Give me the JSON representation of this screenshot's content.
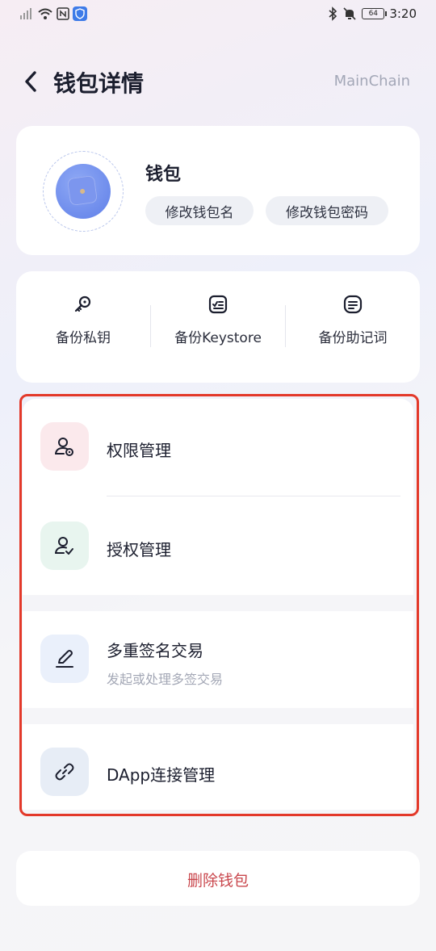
{
  "status_bar": {
    "time": "3:20",
    "battery": "64",
    "icons": [
      "signal-icon",
      "wifi-icon",
      "nfc-icon",
      "shield-app-icon",
      "bluetooth-icon",
      "mute-icon",
      "battery-icon"
    ]
  },
  "header": {
    "title": "钱包详情",
    "network": "MainChain"
  },
  "wallet": {
    "name": "钱包",
    "rename_label": "修改钱包名",
    "change_password_label": "修改钱包密码"
  },
  "backup": {
    "items": [
      {
        "label": "备份私钥",
        "icon": "key-icon"
      },
      {
        "label": "备份Keystore",
        "icon": "keystore-icon"
      },
      {
        "label": "备份助记词",
        "icon": "mnemonic-icon"
      }
    ]
  },
  "menu": {
    "items": [
      {
        "label": "权限管理",
        "icon": "user-settings-icon",
        "icon_bg": "#fbe9ec"
      },
      {
        "label": "授权管理",
        "icon": "user-check-icon",
        "icon_bg": "#e8f5ef"
      },
      {
        "label": "多重签名交易",
        "sub": "发起或处理多签交易",
        "icon": "pen-icon",
        "icon_bg": "#eaf0fb"
      },
      {
        "label": "DApp连接管理",
        "icon": "link-icon",
        "icon_bg": "#e7edf6"
      }
    ]
  },
  "delete": {
    "label": "删除钱包"
  },
  "colors": {
    "highlight_border": "#e3392a",
    "delete_text": "#c9464c",
    "muted_text": "#a4a8b6"
  }
}
